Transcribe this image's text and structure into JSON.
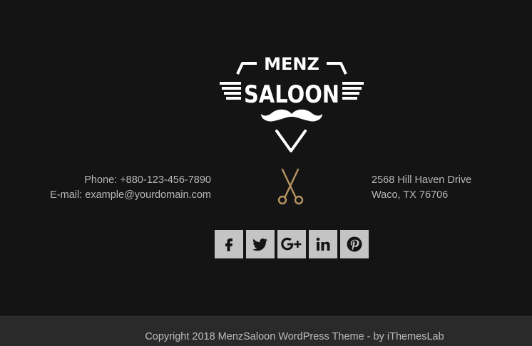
{
  "logo": {
    "line1": "MENZ",
    "line2": "SALOON"
  },
  "contact": {
    "phone": "Phone: +880-123-456-7890",
    "email": "E-mail: example@yourdomain.com",
    "address_line1": "2568 Hill Haven Drive",
    "address_line2": "Waco, TX 76706"
  },
  "social": [
    {
      "name": "facebook",
      "icon": "facebook-icon"
    },
    {
      "name": "twitter",
      "icon": "twitter-icon"
    },
    {
      "name": "google-plus",
      "icon": "google-plus-icon"
    },
    {
      "name": "linkedin",
      "icon": "linkedin-icon"
    },
    {
      "name": "pinterest",
      "icon": "pinterest-icon"
    }
  ],
  "footer": {
    "copyright": "Copyright 2018 MenzSaloon WordPress Theme - by iThemesLab"
  },
  "colors": {
    "background": "#141414",
    "bottom_bar": "#2a2a2a",
    "text": "#b8b8b8",
    "social_bg": "#c4c4c4",
    "scissors": "#b89563"
  }
}
